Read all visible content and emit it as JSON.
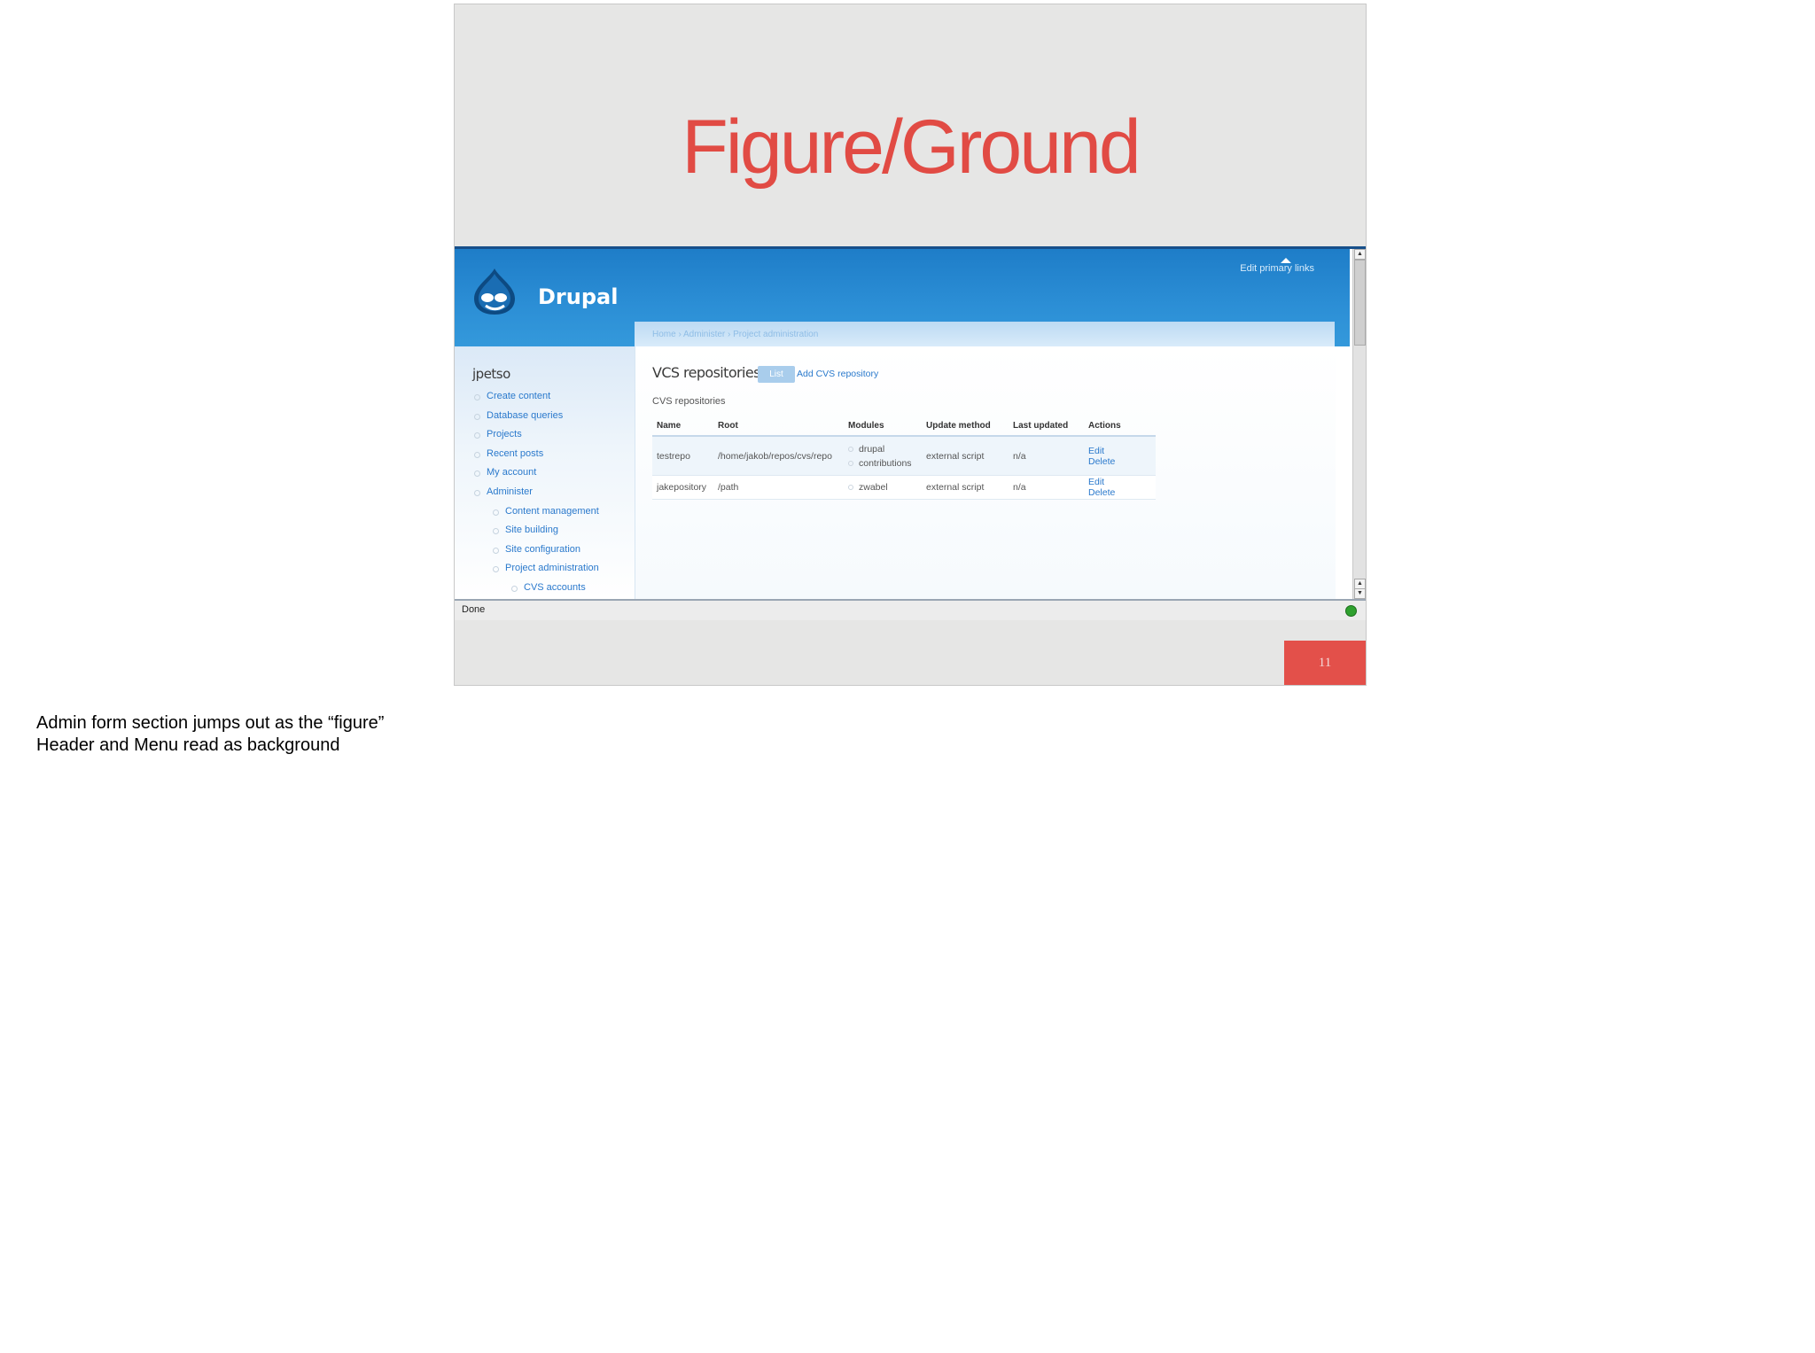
{
  "slide": {
    "title": "Figure/Ground",
    "page_number": "11",
    "colors": {
      "title": "#e14b44",
      "badge": "#e3504a",
      "background": "#e6e6e5"
    }
  },
  "drupal": {
    "site_name": "Drupal",
    "primary_links_label": "Edit primary links",
    "breadcrumb": "Home › Administer › Project administration",
    "sidebar": {
      "username": "jpetso",
      "items": [
        {
          "label": "Create content",
          "level": 1
        },
        {
          "label": "Database queries",
          "level": 1
        },
        {
          "label": "Projects",
          "level": 1
        },
        {
          "label": "Recent posts",
          "level": 1
        },
        {
          "label": "My account",
          "level": 1
        },
        {
          "label": "Administer",
          "level": 1
        },
        {
          "label": "Content management",
          "level": 2
        },
        {
          "label": "Site building",
          "level": 2
        },
        {
          "label": "Site configuration",
          "level": 2
        },
        {
          "label": "Project administration",
          "level": 2
        },
        {
          "label": "CVS accounts",
          "level": 3
        }
      ]
    },
    "content": {
      "page_title": "VCS repositories",
      "tabs": [
        {
          "label": "List",
          "active": true
        },
        {
          "label": "Add CVS repository",
          "active": false
        }
      ],
      "section_title": "CVS repositories",
      "table": {
        "headers": [
          "Name",
          "Root",
          "Modules",
          "Update method",
          "Last updated",
          "Actions"
        ],
        "rows": [
          {
            "name": "testrepo",
            "root": "/home/jakob/repos/cvs/repo",
            "modules": [
              "drupal",
              "contributions"
            ],
            "update_method": "external script",
            "last_updated": "n/a",
            "actions": [
              "Edit",
              "Delete"
            ]
          },
          {
            "name": "jakepository",
            "root": "/path",
            "modules": [
              "zwabel"
            ],
            "update_method": "external script",
            "last_updated": "n/a",
            "actions": [
              "Edit",
              "Delete"
            ]
          }
        ]
      }
    },
    "status_text": "Done"
  },
  "notes": {
    "line1": "Admin form section jumps out as the “figure”",
    "line2": "Header and Menu read as background"
  }
}
